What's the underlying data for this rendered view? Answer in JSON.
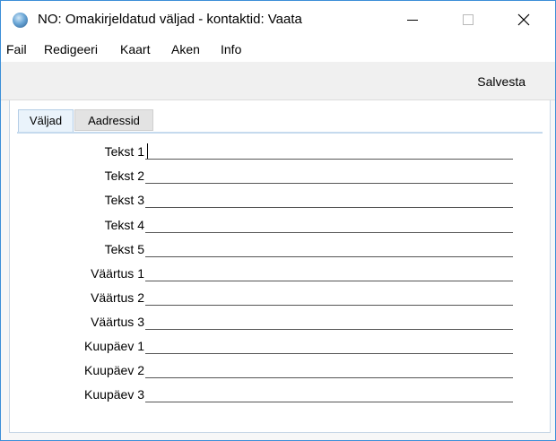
{
  "window": {
    "title": "NO: Omakirjeldatud väljad - kontaktid: Vaata",
    "icon": "app-globe-icon"
  },
  "menu": [
    "Fail",
    "Redigeeri",
    "Kaart",
    "Aken",
    "Info"
  ],
  "toolbar": {
    "save_label": "Salvesta"
  },
  "tabs": [
    {
      "label": "Väljad",
      "active": true
    },
    {
      "label": "Aadressid",
      "active": false
    }
  ],
  "fields": [
    {
      "label": "Tekst 1",
      "value": ""
    },
    {
      "label": "Tekst 2",
      "value": ""
    },
    {
      "label": "Tekst 3",
      "value": ""
    },
    {
      "label": "Tekst 4",
      "value": ""
    },
    {
      "label": "Tekst 5",
      "value": ""
    },
    {
      "label": "Väärtus 1",
      "value": ""
    },
    {
      "label": "Väärtus 2",
      "value": ""
    },
    {
      "label": "Väärtus 3",
      "value": ""
    },
    {
      "label": "Kuupäev 1",
      "value": ""
    },
    {
      "label": "Kuupäev 2",
      "value": ""
    },
    {
      "label": "Kuupäev 3",
      "value": ""
    }
  ],
  "colors": {
    "window_border": "#3c8fd8",
    "toolbar_bg": "#f0f0f0",
    "tab_active_bg": "#eaf3fb",
    "tab_rule": "#c5daee"
  }
}
